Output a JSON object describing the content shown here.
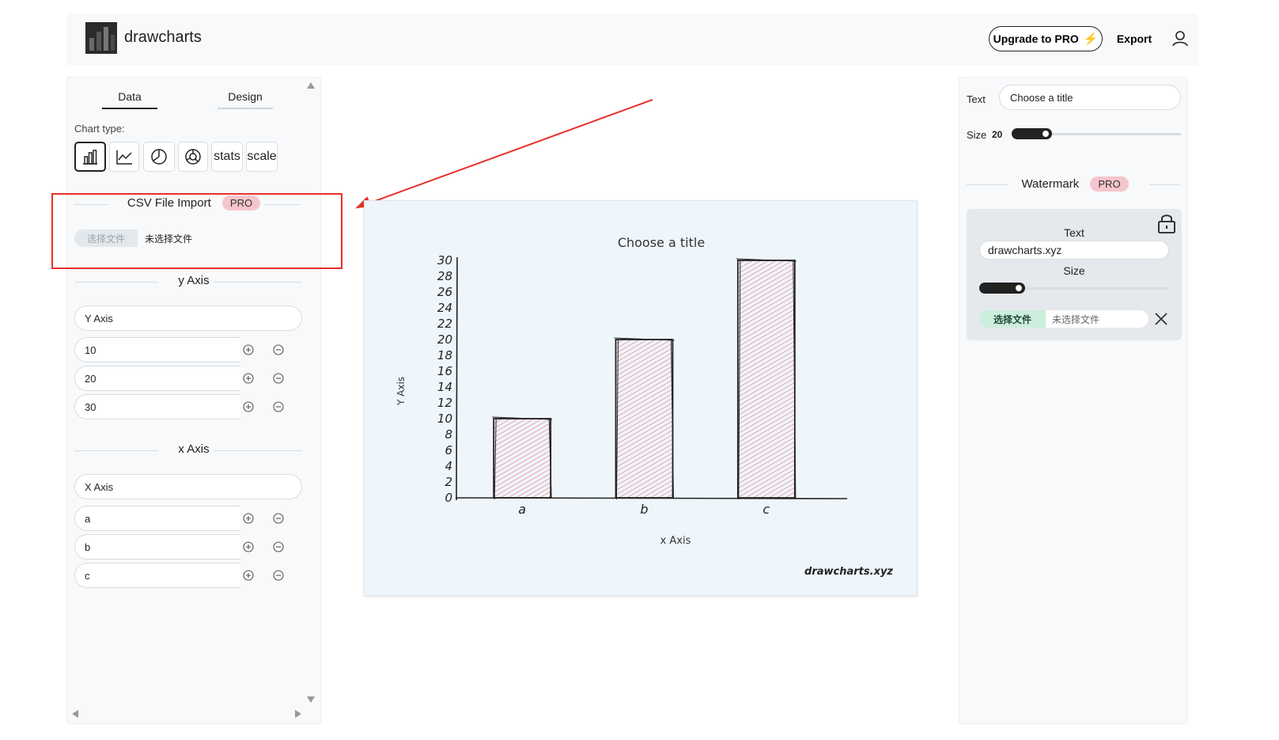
{
  "header": {
    "app_title": "drawcharts",
    "upgrade_label": "Upgrade to PRO",
    "export_label": "Export"
  },
  "left_panel": {
    "tabs": [
      "Data",
      "Design"
    ],
    "chart_type_label": "Chart type:",
    "chart_types": [
      "bar-chart-icon",
      "line-chart-icon",
      "pie-chart-icon",
      "donut-chart-icon",
      "stats",
      "scale"
    ],
    "csv": {
      "title": "CSV File Import",
      "badge": "PRO",
      "choose_file": "选择文件",
      "no_file": "未选择文件"
    },
    "y_axis": {
      "section_title": "y Axis",
      "name": "Y Axis",
      "values": [
        "10",
        "20",
        "30"
      ]
    },
    "x_axis": {
      "section_title": "x Axis",
      "name": "X Axis",
      "values": [
        "a",
        "b",
        "c"
      ]
    }
  },
  "right_panel": {
    "text_label": "Text",
    "title_placeholder": "Choose a title",
    "size_label": "Size",
    "size_value": "20",
    "size_level": 0.1,
    "watermark": {
      "title": "Watermark",
      "badge": "PRO",
      "text_label": "Text",
      "text_value": "drawcharts.xyz",
      "size_label": "Size",
      "size_level": 0.2,
      "choose_file": "选择文件",
      "no_file": "未选择文件"
    }
  },
  "chart_data": {
    "type": "bar",
    "title": "Choose a title",
    "xlabel": "x Axis",
    "ylabel": "Y Axis",
    "categories": [
      "a",
      "b",
      "c"
    ],
    "values": [
      10,
      20,
      30
    ],
    "ylim": [
      0,
      30
    ],
    "yticks": [
      "0",
      "2",
      "4",
      "6",
      "8",
      "10",
      "12",
      "14",
      "16",
      "18",
      "20",
      "22",
      "24",
      "26",
      "28",
      "30"
    ],
    "watermark": "drawcharts.xyz",
    "bar_color": "#e8838f"
  }
}
